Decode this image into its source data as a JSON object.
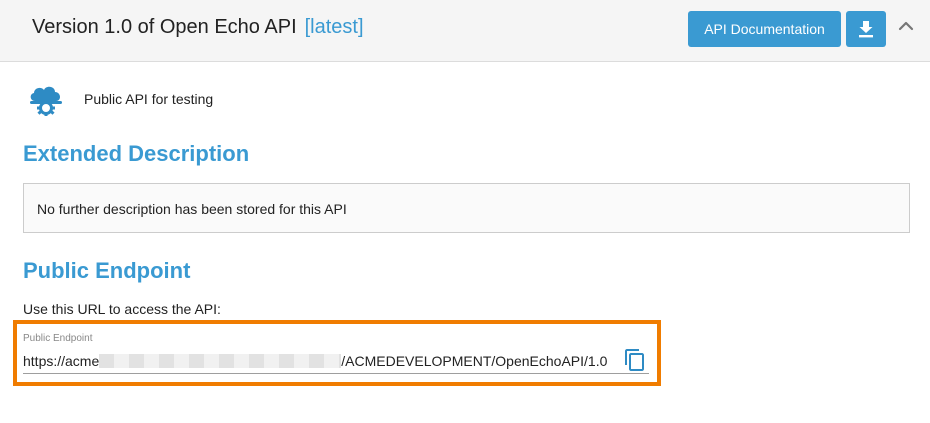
{
  "header": {
    "title": "Version 1.0 of Open Echo API",
    "tag": "[latest]",
    "docs_button_label": "API Documentation",
    "download_icon": "download-icon",
    "collapse_icon": "chevron-up-icon"
  },
  "summary": {
    "icon": "cloud-gear-icon",
    "text": "Public API for testing"
  },
  "extended_description": {
    "heading": "Extended Description",
    "text": "No further description has been stored for this API"
  },
  "public_endpoint": {
    "heading": "Public Endpoint",
    "instructions": "Use this URL to access the API:",
    "field_label": "Public Endpoint",
    "url_prefix": "https://acme",
    "url_suffix": "/ACMEDEVELOPMENT/OpenEchoAPI/1.0",
    "copy_icon": "copy-icon"
  },
  "colors": {
    "accent": "#3a9ad2",
    "highlight": "#f07c00"
  }
}
